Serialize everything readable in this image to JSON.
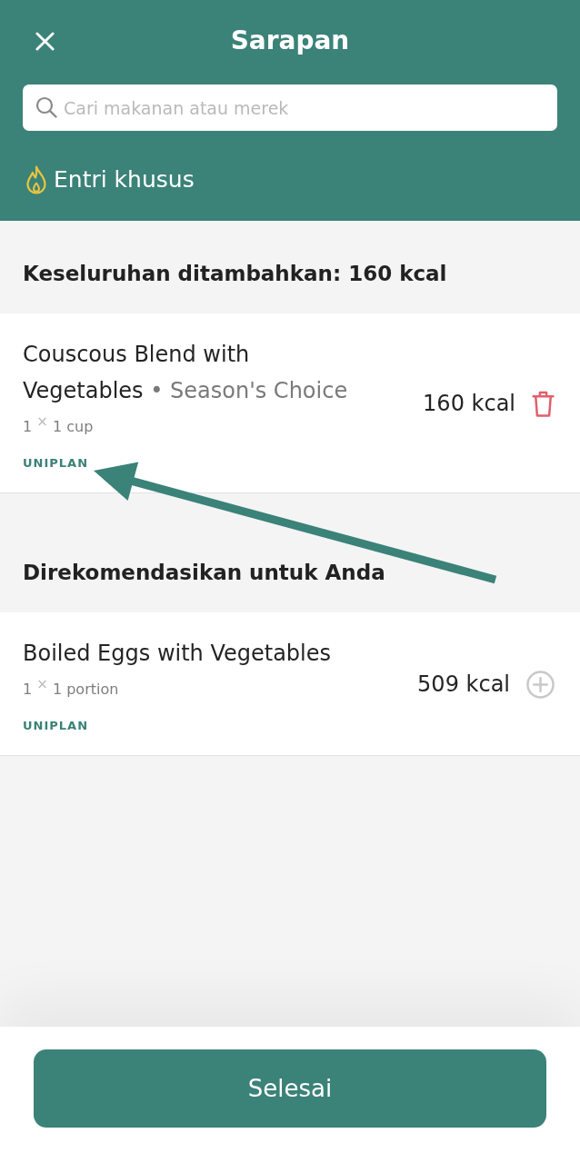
{
  "header": {
    "title": "Sarapan",
    "search": {
      "placeholder": "Cari makanan atau merek"
    },
    "custom_entry": {
      "label": "Entri khusus"
    }
  },
  "sections": [
    {
      "title": "Keseluruhan ditambahkan: 160 kcal",
      "items": [
        {
          "kind": "added",
          "name": "Couscous Blend with Vegetables",
          "brand": "• Season's Choice",
          "quantity": "1 $^{×}$ 1 cup",
          "tag": "UNIPLAN",
          "calories": "160 kcal"
        }
      ]
    },
    {
      "title": "Direkomendasikan untuk Anda",
      "items": [
        {
          "kind": "recommended",
          "name": "Boiled Eggs with Vegetables",
          "quantity": "1 $^{×}$ 1 portion",
          "tag": "UNIPLAN",
          "calories": "509 kcal"
        }
      ]
    }
  ],
  "footer": {
    "button": "Selesai"
  }
}
